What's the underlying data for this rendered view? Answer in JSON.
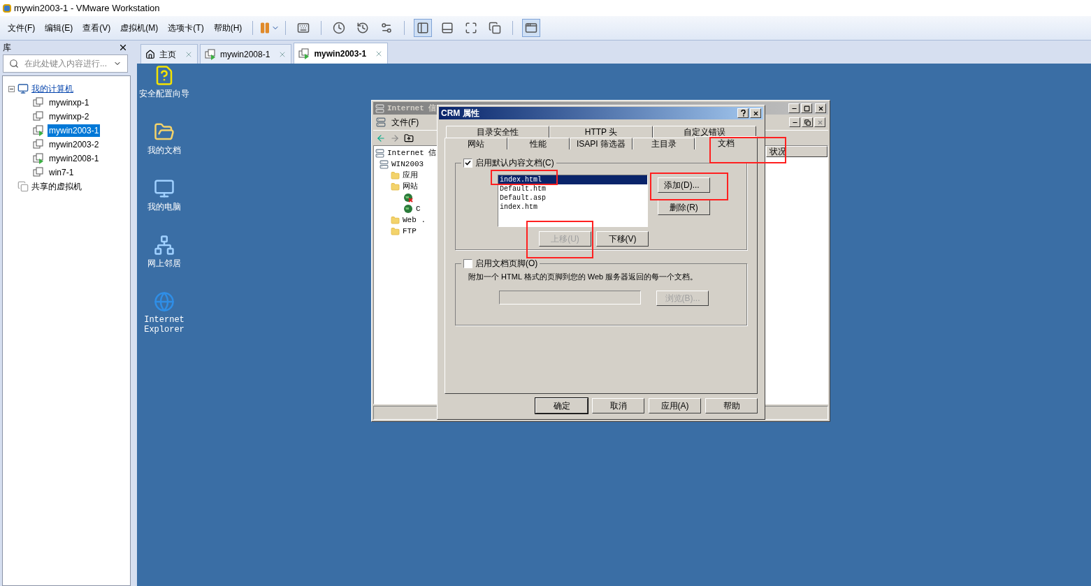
{
  "window": {
    "title": "mywin2003-1 - VMware Workstation"
  },
  "menu": [
    "文件(F)",
    "编辑(E)",
    "查看(V)",
    "虚拟机(M)",
    "选项卡(T)",
    "帮助(H)"
  ],
  "library": {
    "title": "库",
    "search": {
      "placeholder": "在此处键入内容进行..."
    },
    "tree": [
      {
        "label": "我的计算机",
        "expanded": true,
        "children": [
          {
            "label": "mywinxp-1",
            "running": false,
            "selected": false
          },
          {
            "label": "mywinxp-2",
            "running": false,
            "selected": false
          },
          {
            "label": "mywin2003-1",
            "running": true,
            "selected": true
          },
          {
            "label": "mywin2003-2",
            "running": false,
            "selected": false
          },
          {
            "label": "mywin2008-1",
            "running": true,
            "selected": false
          },
          {
            "label": "win7-1",
            "running": false,
            "selected": false
          }
        ]
      },
      {
        "label": "共享的虚拟机"
      }
    ]
  },
  "tabs": [
    {
      "label": "主页",
      "kind": "home",
      "selected": false
    },
    {
      "label": "mywin2008-1",
      "kind": "vm",
      "selected": false
    },
    {
      "label": "mywin2003-1",
      "kind": "vm",
      "selected": true
    }
  ],
  "desktop_icons": [
    {
      "label": "安全配置向导",
      "kind": "wizard"
    },
    {
      "label": "我的文档",
      "kind": "documents"
    },
    {
      "label": "我的电脑",
      "kind": "computer"
    },
    {
      "label": "网上邻居",
      "kind": "network"
    },
    {
      "label": "Internet Explorer",
      "kind": "browser"
    }
  ],
  "iis_window": {
    "title": "Internet 信",
    "menu": [
      "文件(F)"
    ],
    "column": "状况",
    "tree": [
      {
        "label": "Internet 信",
        "children": [
          {
            "label": "WIN2003",
            "children": [
              {
                "label": "应用"
              },
              {
                "label": "网站",
                "children": [
                  {
                    "stopped": true
                  },
                  {
                    "label": "C",
                    "stopped": false
                  }
                ]
              },
              {
                "label": "Web ."
              },
              {
                "label": "FTP"
              }
            ]
          }
        ]
      }
    ]
  },
  "dialog": {
    "title": "CRM 属性",
    "tab_rows": [
      [
        {
          "label": "目录安全性",
          "selected": false
        },
        {
          "label": "HTTP 头",
          "selected": false
        },
        {
          "label": "自定义错误",
          "selected": false
        }
      ],
      [
        {
          "label": "网站",
          "selected": false
        },
        {
          "label": "性能",
          "selected": false
        },
        {
          "label": "ISAPI 筛选器",
          "selected": false
        },
        {
          "label": "主目录",
          "selected": false
        },
        {
          "label": "文档",
          "selected": true
        }
      ]
    ],
    "default_docs": {
      "label": "启用默认内容文档(C)",
      "checked": true,
      "items": [
        {
          "name": "index.html",
          "selected": true
        },
        {
          "name": "Default.htm",
          "selected": false
        },
        {
          "name": "Default.asp",
          "selected": false
        },
        {
          "name": "index.htm",
          "selected": false
        }
      ],
      "add": {
        "label": "添加(D)...",
        "disabled": false
      },
      "remove": {
        "label": "删除(R)",
        "disabled": false
      },
      "up": {
        "label": "上移(U)",
        "disabled": true
      },
      "down": {
        "label": "下移(V)",
        "disabled": false
      }
    },
    "footer": {
      "label": "启用文档页脚(O)",
      "checked": false,
      "description": "附加一个 HTML 格式的页脚到您的 Web 服务器返回的每一个文档。",
      "browse": {
        "label": "浏览(B)...",
        "disabled": true
      }
    },
    "buttons": [
      {
        "label": "确定",
        "default": true
      },
      {
        "label": "取消",
        "default": false
      },
      {
        "label": "应用(A)",
        "default": false
      },
      {
        "label": "帮助",
        "default": false
      }
    ]
  }
}
